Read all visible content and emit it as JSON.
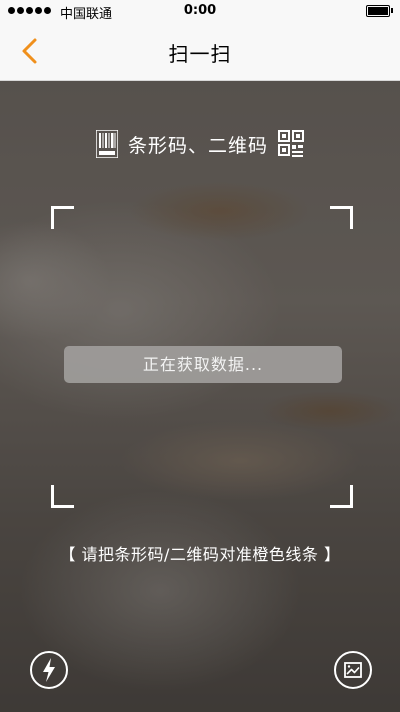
{
  "status_bar": {
    "carrier": "中国联通",
    "time": "0:00",
    "signal_icon": "signal-dots-icon",
    "battery_icon": "battery-icon"
  },
  "nav": {
    "title": "扫一扫",
    "back_icon": "chevron-left-icon",
    "accent_color": "#f0901c"
  },
  "scanner": {
    "mode_label": "条形码、二维码",
    "barcode_icon": "barcode-icon",
    "qrcode_icon": "qrcode-icon",
    "loading_text": "正在获取数据...",
    "hint": "【 请把条形码/二维码对准橙色线条 】"
  },
  "toolbar": {
    "flash_icon": "flash-icon",
    "album_icon": "image-album-icon"
  }
}
